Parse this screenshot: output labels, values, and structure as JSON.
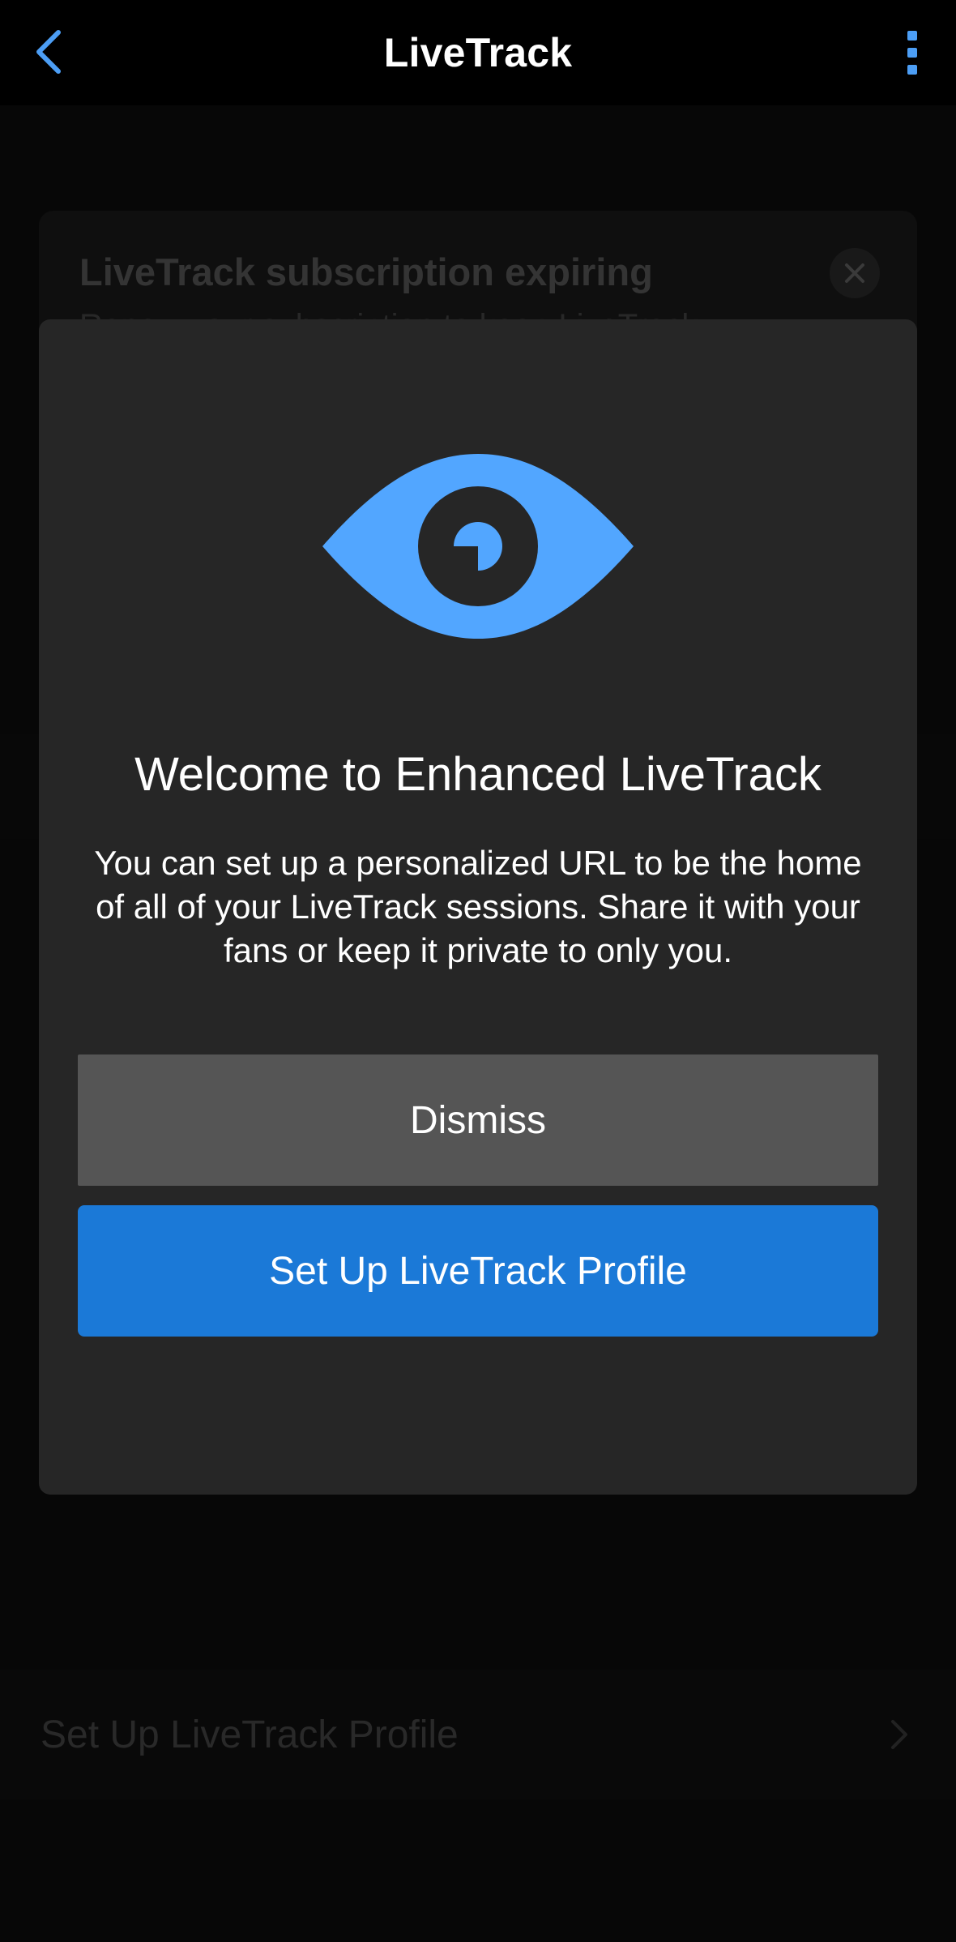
{
  "nav": {
    "title": "LiveTrack",
    "back_icon": "chevron-left-icon",
    "menu_icon": "kebab-menu-icon",
    "accent_color": "#4c9ef5"
  },
  "background": {
    "card_title": "LiveTrack subscription expiring",
    "card_subtitle": "Renew your subscription to keep LiveTrack",
    "row_label": "Set Up LiveTrack Profile"
  },
  "modal": {
    "icon": "eye-icon",
    "icon_color": "#52a6ff",
    "title": "Welcome to Enhanced LiveTrack",
    "body": "You can set up a personalized URL to be the home of all of your LiveTrack sessions. Share it with your fans or keep it private to only you.",
    "dismiss_label": "Dismiss",
    "setup_label": "Set Up LiveTrack Profile",
    "setup_color": "#1b79d7"
  }
}
